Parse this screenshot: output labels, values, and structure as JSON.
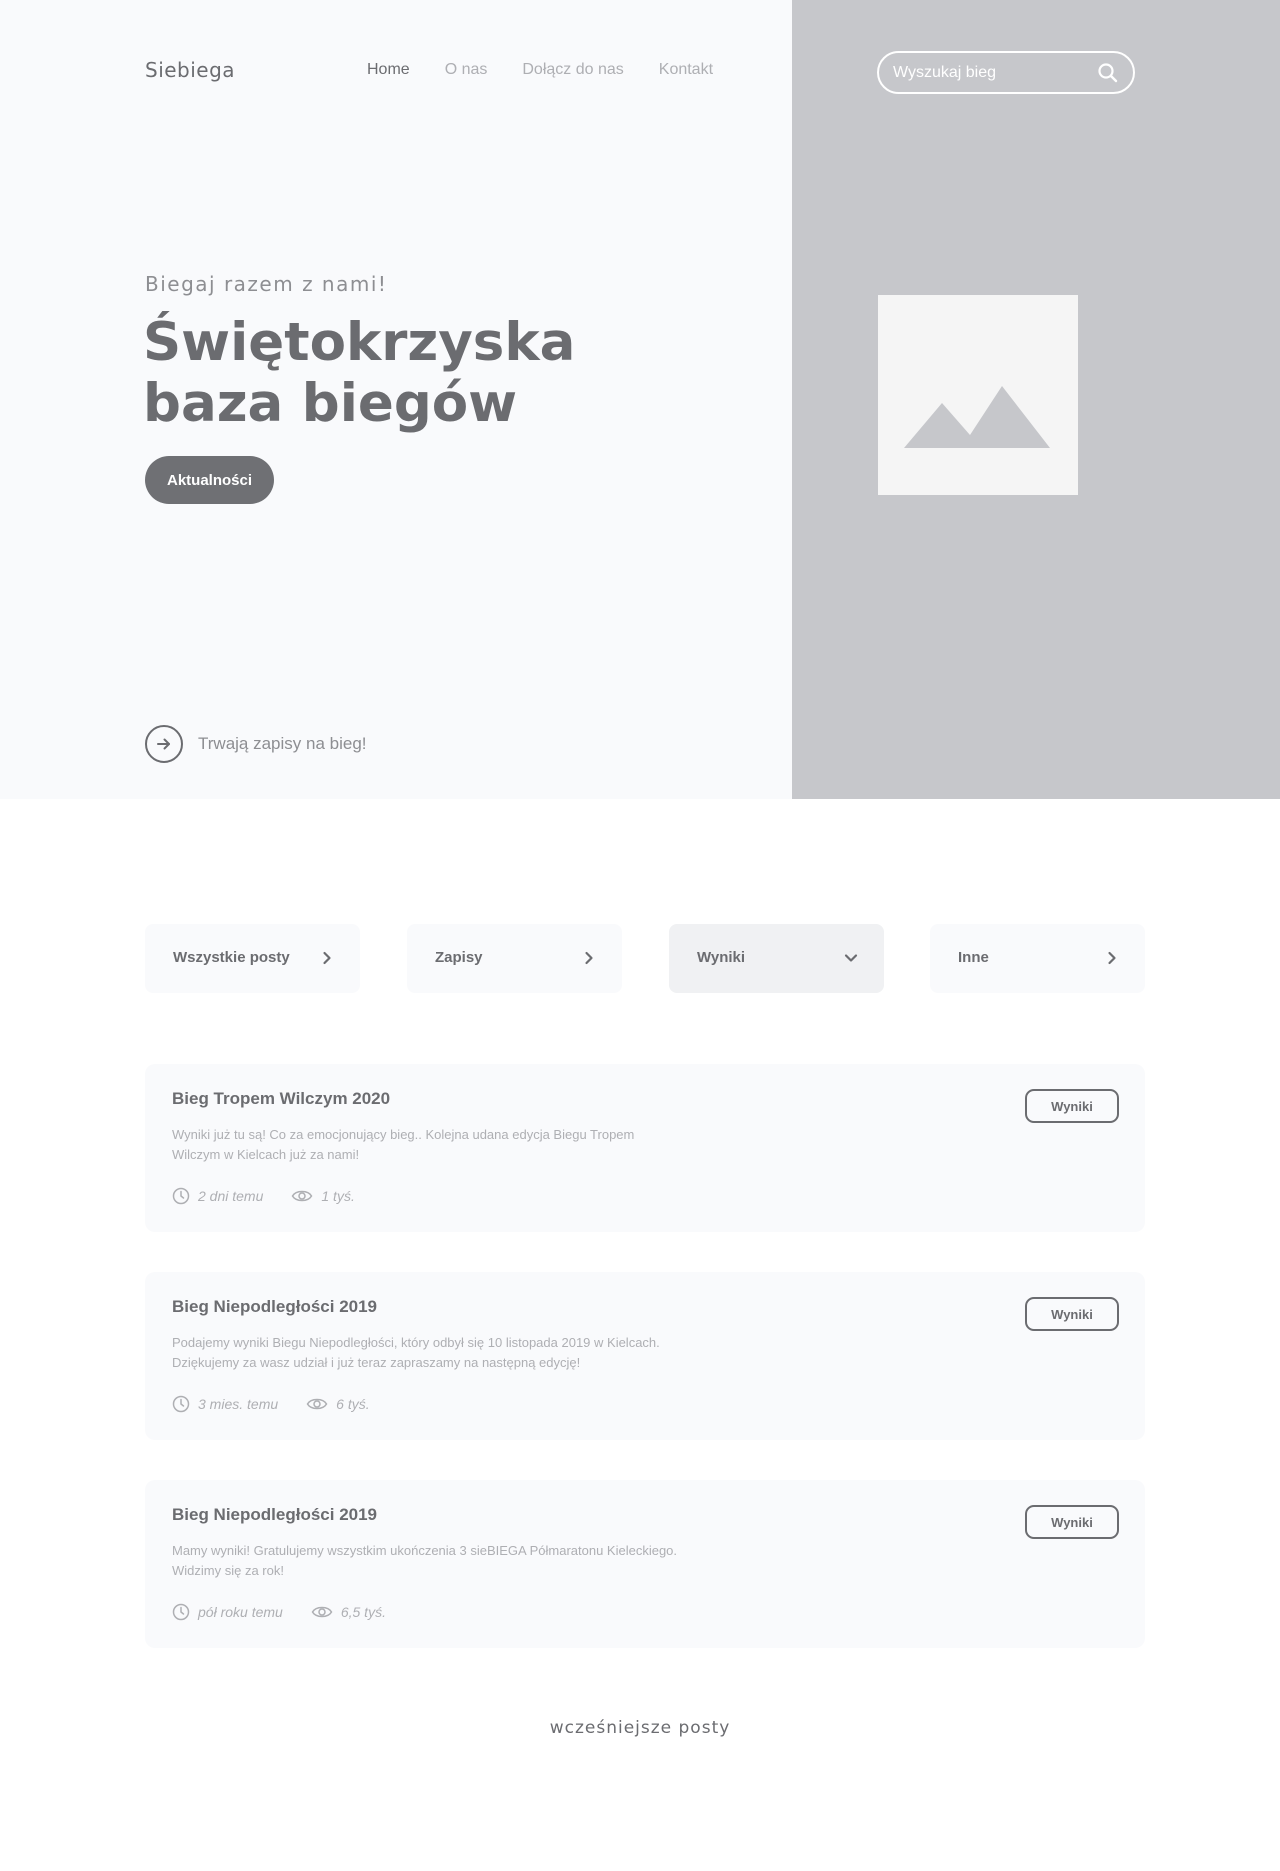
{
  "header": {
    "logo": "Siebiega",
    "nav": [
      {
        "label": "Home"
      },
      {
        "label": "O nas"
      },
      {
        "label": "Dołącz do nas"
      },
      {
        "label": "Kontakt"
      }
    ],
    "search_placeholder": "Wyszukaj bieg"
  },
  "hero": {
    "subtitle": "Biegaj razem z nami!",
    "title_line1": "Świętokrzyska",
    "title_line2": "baza biegów",
    "button": "Aktualności",
    "signup_text": "Trwają zapisy na bieg!"
  },
  "filters": [
    {
      "label": "Wszystkie posty",
      "icon": "chevron-right-icon"
    },
    {
      "label": "Zapisy",
      "icon": "chevron-right-icon"
    },
    {
      "label": "Wyniki",
      "icon": "chevron-down-icon",
      "active": true
    },
    {
      "label": "Inne",
      "icon": "chevron-right-icon"
    }
  ],
  "posts": [
    {
      "title": "Bieg Tropem Wilczym 2020",
      "desc_line1": "Wyniki już tu są! Co za emocjonujący bieg..  Kolejna udana edycja Biegu Tropem",
      "desc_line2": "Wilczym w Kielcach już za nami!",
      "time": "2 dni temu",
      "views": "1 tyś.",
      "button": "Wyniki"
    },
    {
      "title": "Bieg Niepodległości 2019",
      "desc_line1": "Podajemy wyniki Biegu Niepodległości, który odbył się 10 listopada 2019 w Kielcach.",
      "desc_line2": "Dziękujemy za wasz udział i już teraz zapraszamy na następną edycję!",
      "time": "3 mies. temu",
      "views": "6 tyś.",
      "button": "Wyniki"
    },
    {
      "title": "Bieg Niepodległości 2019",
      "desc_line1": "Mamy wyniki! Gratulujemy wszystkim ukończenia 3 sieBIEGA Półmaratonu Kieleckiego.",
      "desc_line2": "Widzimy się za rok!",
      "time": "pół roku temu",
      "views": "6,5 tyś.",
      "button": "Wyniki"
    }
  ],
  "more_posts": "wcześniejsze posty",
  "colors": {
    "accent": "#6b6c70",
    "hero_left_bg": "#f9fafc",
    "hero_right_bg": "#c6c7cb",
    "muted_text": "#aeafb3"
  }
}
